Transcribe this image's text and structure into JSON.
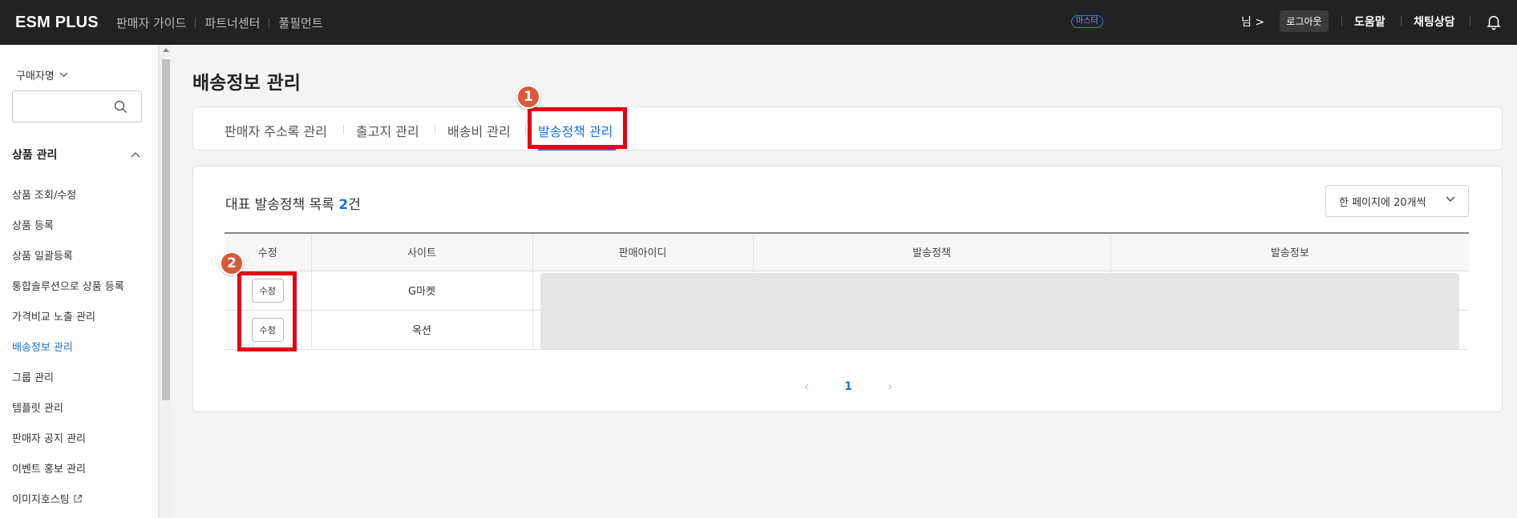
{
  "header": {
    "logo": "ESM PLUS",
    "nav": [
      "판매자 가이드",
      "파트너센터",
      "풀필먼트"
    ],
    "master_badge": "마스터",
    "user_suffix": "님 >",
    "logout": "로그아웃",
    "help": "도움말",
    "chat": "채팅상담",
    "icons": {
      "bell": "bell-icon"
    }
  },
  "sidebar": {
    "buyer_dropdown": "구매자명",
    "search_placeholder": "",
    "section": "상품 관리",
    "items": [
      {
        "label": "상품 조회/수정",
        "active": false
      },
      {
        "label": "상품 등록",
        "active": false
      },
      {
        "label": "상품 일괄등록",
        "active": false
      },
      {
        "label": "통합솔루션으로 상품 등록",
        "active": false
      },
      {
        "label": "가격비교 노출 관리",
        "active": false
      },
      {
        "label": "배송정보 관리",
        "active": true
      },
      {
        "label": "그룹 관리",
        "active": false
      },
      {
        "label": "템플릿 관리",
        "active": false
      },
      {
        "label": "판매자 공지 관리",
        "active": false
      },
      {
        "label": "이벤트 홍보 관리",
        "active": false
      },
      {
        "label": "이미지호스팅",
        "active": false
      }
    ]
  },
  "main": {
    "title": "배송정보 관리",
    "tabs": [
      {
        "label": "판매자 주소록 관리",
        "active": false
      },
      {
        "label": "출고지 관리",
        "active": false
      },
      {
        "label": "배송비 관리",
        "active": false
      },
      {
        "label": "발송정책 관리",
        "active": true
      }
    ],
    "list": {
      "title_prefix": "대표 발송정책 목록 ",
      "count": "2",
      "title_suffix": "건",
      "page_size": "한 페이지에 20개씩",
      "columns": [
        "수정",
        "사이트",
        "판매아이디",
        "발송정책",
        "발송정보"
      ],
      "rows": [
        {
          "edit": "수정",
          "site": "G마켓"
        },
        {
          "edit": "수정",
          "site": "옥션"
        }
      ]
    },
    "pagination": {
      "prev": "‹",
      "current": "1",
      "next": "›"
    },
    "annotations": [
      "1",
      "2"
    ]
  },
  "colors": {
    "accent": "#1a73e8",
    "highlight": "#e60012",
    "badge": "#d9593d",
    "topbar": "#222222"
  }
}
